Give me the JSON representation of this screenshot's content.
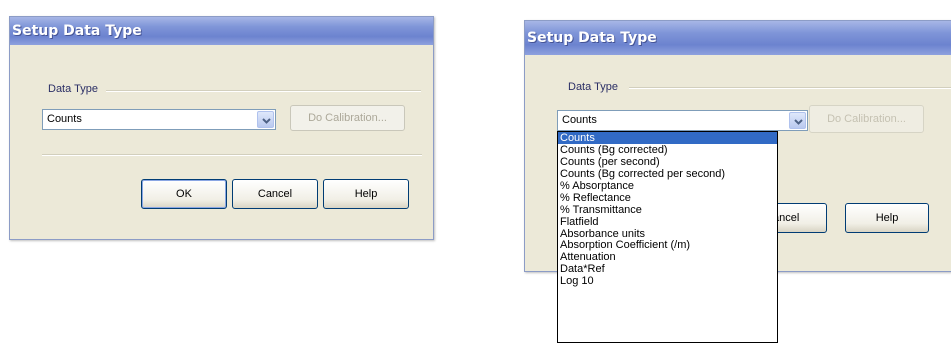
{
  "left_dialog": {
    "title": "Setup Data Type",
    "group_label": "Data Type",
    "selected": "Counts",
    "calibration_button": "Do Calibration...",
    "ok_button": "OK",
    "cancel_button": "Cancel",
    "help_button": "Help"
  },
  "right_dialog": {
    "title": "Setup Data Type",
    "group_label": "Data Type",
    "selected": "Counts",
    "calibration_button": "Do Calibration...",
    "cancel_button_partial": "ancel",
    "help_button": "Help",
    "options": [
      "Counts",
      "Counts (Bg corrected)",
      "Counts (per second)",
      "Counts (Bg corrected per second)",
      "% Absorptance",
      "% Reflectance",
      "% Transmittance",
      "Flatfield",
      "Absorbance units",
      "Absorption Coefficient (/m)",
      "Attenuation",
      "Data*Ref",
      "Log 10"
    ],
    "highlighted_option": "Counts"
  },
  "colors": {
    "dialog_bg": "#ece9d8",
    "title_gradient": "#7f95d8",
    "selection": "#316ac5"
  }
}
